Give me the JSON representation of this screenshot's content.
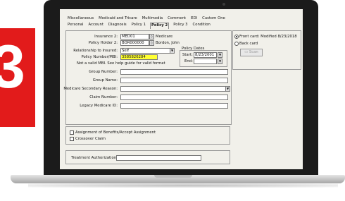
{
  "badge": {
    "number": "3",
    "color": "#e21b1b"
  },
  "tabs": {
    "row1": [
      "Miscellaneous",
      "Medicaid and Tricare",
      "Multimedia",
      "Comment",
      "EDI",
      "Custom One"
    ],
    "row2": [
      "Personal",
      "Account",
      "Diagnosis",
      "Policy 1",
      "Policy 2",
      "Policy 3",
      "Condition"
    ],
    "active": "Policy 2"
  },
  "fields": {
    "insurance2_label": "Insurance 2:",
    "insurance2_value": "MED01",
    "insurance2_name": "Medicare",
    "policy_holder2_label": "Policy Holder 2:",
    "policy_holder2_value": "BOR000000",
    "policy_holder2_name": "Bordon, John",
    "relationship_label": "Relationship to Insured:",
    "relationship_value": "Self",
    "policy_dates_label": "Policy Dates",
    "start_label": "Start:",
    "start_value": "8/23/2001",
    "end_label": "End:",
    "end_value": "",
    "policy_number_label": "Policy Number/MBI:",
    "policy_number_value": "3585826284",
    "invalid_msg": "Not a valid MBI. See help guide for valid format",
    "group_number_label": "Group Number:",
    "group_name_label": "Group Name:",
    "medicare_secondary_label": "Medicare Secondary Reason:",
    "claim_number_label": "Claim Number:",
    "legacy_medicare_label": "Legacy Medicare ID:"
  },
  "card": {
    "front_label": "Front card: Modified 8/23/2018",
    "back_label": "Back card",
    "scan_label": "Scan"
  },
  "checkboxes": {
    "assignment": "Assignment of Benefits/Accept Assignment",
    "crossover": "Crossover Claim"
  },
  "treatment": {
    "label": "Treatment Authorization:"
  }
}
